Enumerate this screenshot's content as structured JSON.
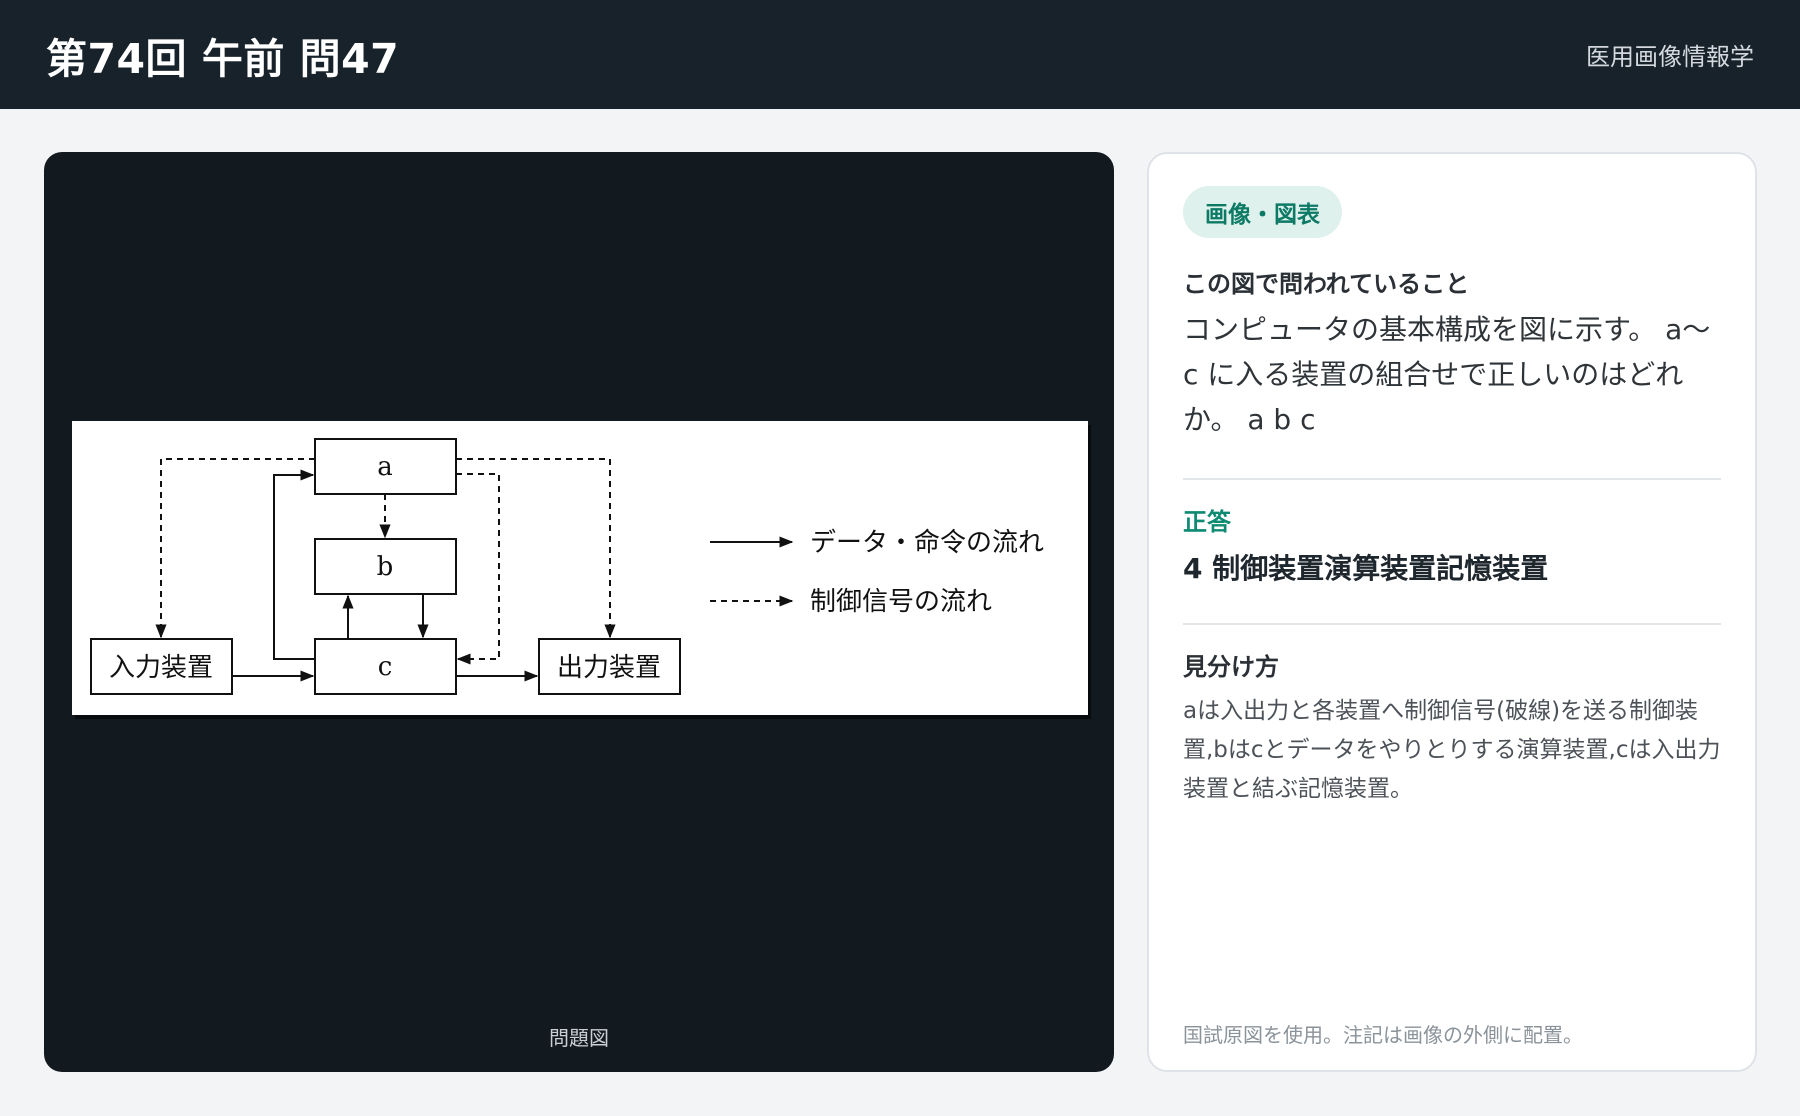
{
  "header": {
    "title": "第74回 午前 問47",
    "subject": "医用画像情報学"
  },
  "viewer": {
    "caption": "問題図",
    "figure": {
      "box_a": "a",
      "box_b": "b",
      "box_c": "c",
      "input_device": "入力装置",
      "output_device": "出力装置",
      "legend_data": "データ・命令の流れ",
      "legend_control": "制御信号の流れ"
    }
  },
  "panel": {
    "badge": "画像・図表",
    "question_title": "この図で問われていること",
    "question_text": "コンピュータの基本構成を図に示す。 a～c に入る装置の組合せで正しいのはどれか。 a b c",
    "answer_label": "正答",
    "answer_value": "4 制御装置演算装置記憶装置",
    "hint_title": "見分け方",
    "hint_text": "aは入出力と各装置へ制御信号(破線)を送る制御装置,bはcとデータをやりとりする演算装置,cは入出力装置と結ぶ記憶装置。",
    "footnote": "国試原図を使用。注記は画像の外側に配置。"
  }
}
